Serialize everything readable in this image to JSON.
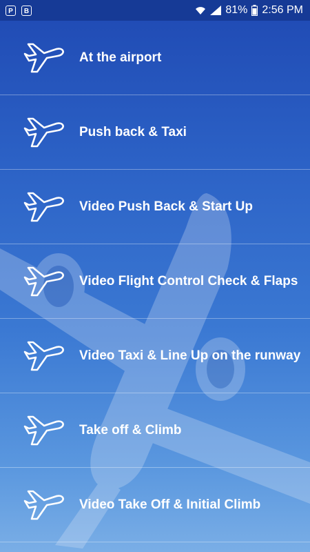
{
  "status_bar": {
    "left_icons": [
      "P",
      "B"
    ],
    "battery": "81%",
    "time": "2:56 PM"
  },
  "menu": {
    "items": [
      {
        "label": "At the airport",
        "icon": "airplane-icon"
      },
      {
        "label": "Push back & Taxi",
        "icon": "airplane-icon"
      },
      {
        "label": "Video Push Back & Start Up",
        "icon": "airplane-icon"
      },
      {
        "label": "Video Flight Control Check & Flaps",
        "icon": "airplane-icon"
      },
      {
        "label": "Video Taxi & Line Up on the runway",
        "icon": "airplane-icon"
      },
      {
        "label": "Take off & Climb",
        "icon": "airplane-icon"
      },
      {
        "label": "Video Take Off & Initial Climb",
        "icon": "airplane-icon"
      }
    ]
  },
  "colors": {
    "status_bar_bg": "#163a96",
    "text": "#ffffff",
    "background_top": "#1f49b3",
    "background_bottom": "#7aaee6"
  }
}
